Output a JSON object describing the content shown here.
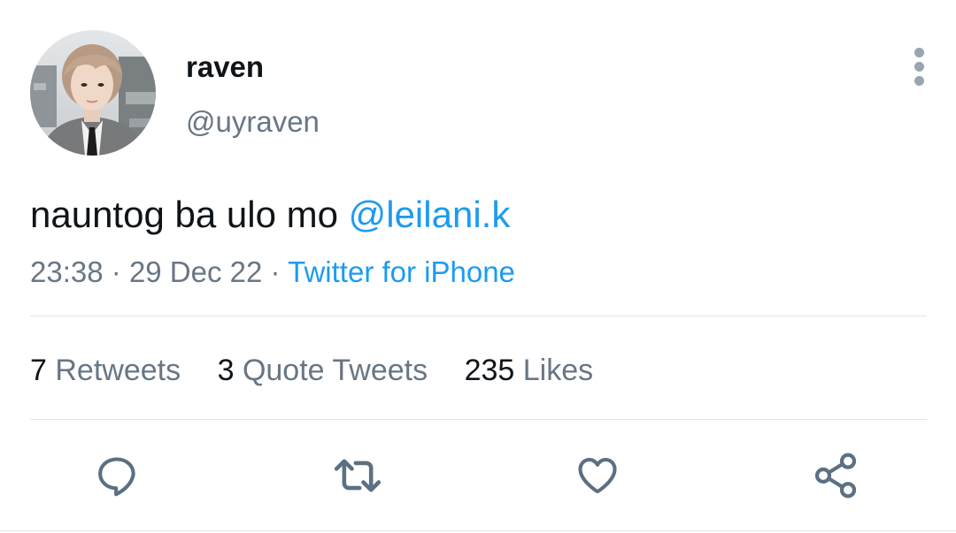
{
  "tweet": {
    "display_name": "raven",
    "handle": "@uyraven",
    "text": "nauntog ba ulo mo ",
    "mention": "@leilani.k",
    "time": "23:38",
    "separator": "·",
    "date": "29 Dec 22",
    "source": "Twitter for iPhone"
  },
  "stats": {
    "retweets": {
      "count": "7",
      "label": "Retweets"
    },
    "quotes": {
      "count": "3",
      "label": "Quote Tweets"
    },
    "likes": {
      "count": "235",
      "label": "Likes"
    }
  },
  "actions": [
    {
      "icon": "reply-icon"
    },
    {
      "icon": "retweet-icon"
    },
    {
      "icon": "like-icon"
    },
    {
      "icon": "share-icon"
    }
  ],
  "colors": {
    "text": "#0f1419",
    "secondary": "#687684",
    "accent": "#1d9bf0",
    "icon": "#5b7083",
    "divider": "#e1e6ea"
  }
}
